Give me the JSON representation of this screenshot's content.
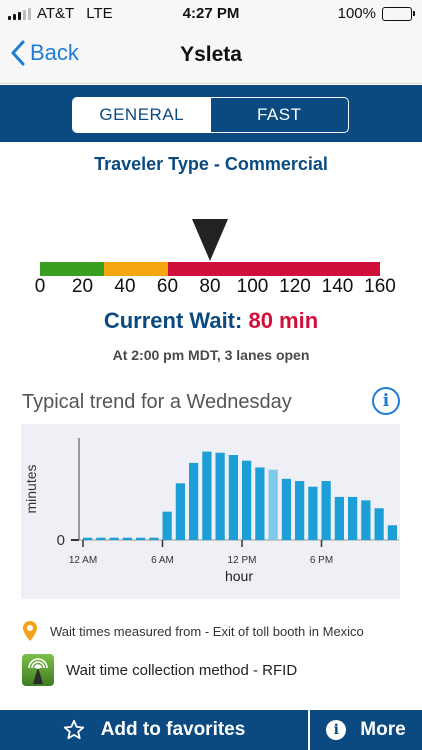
{
  "status_bar": {
    "carrier": "AT&T",
    "network": "LTE",
    "time": "4:27 PM",
    "battery_percent": "100%",
    "battery_level": 1.0,
    "signal_bars": 3,
    "signal_max": 5
  },
  "nav": {
    "back_label": "Back",
    "title": "Ysleta"
  },
  "segment": {
    "options": [
      "GENERAL",
      "FAST"
    ],
    "selected": "GENERAL"
  },
  "traveler_type": "Traveler Type - Commercial",
  "gauge": {
    "ticks": [
      "0",
      "20",
      "40",
      "60",
      "80",
      "100",
      "120",
      "140",
      "160"
    ],
    "min": 0,
    "max": 160,
    "value": 80,
    "segments": [
      {
        "from": 0,
        "to": 30,
        "color": "#3a9e1f"
      },
      {
        "from": 30,
        "to": 60,
        "color": "#f5a712"
      },
      {
        "from": 60,
        "to": 160,
        "color": "#d0103a"
      }
    ]
  },
  "current_wait": {
    "label": "Current Wait:",
    "value": "80 min"
  },
  "wait_detail": "At 2:00 pm MDT, 3 lanes open",
  "trend_title": "Typical trend for a Wednesday",
  "chart_data": {
    "type": "bar",
    "ylabel": "minutes",
    "xlabel": "hour",
    "y_tick_labels": [
      "0"
    ],
    "x_tick_labels": [
      "12 AM",
      "6 AM",
      "12 PM",
      "6 PM"
    ],
    "x_tick_hours": [
      0,
      6,
      12,
      18
    ],
    "hours": [
      0,
      1,
      2,
      3,
      4,
      5,
      6,
      7,
      8,
      9,
      10,
      11,
      12,
      13,
      14,
      15,
      16,
      17,
      18,
      19,
      20,
      21,
      22,
      23
    ],
    "values": [
      2,
      2,
      2,
      2,
      2,
      2,
      25,
      50,
      68,
      78,
      77,
      75,
      70,
      64,
      62,
      54,
      52,
      47,
      52,
      38,
      38,
      35,
      28,
      13
    ],
    "highlight_hour": 14,
    "bar_color": "#1c9fd6",
    "highlight_color": "#7fcaea",
    "ylim": [
      0,
      90
    ]
  },
  "info_rows": {
    "measured_from": "Wait times measured from - Exit of toll booth in Mexico",
    "collection_method": "Wait time collection method - RFID"
  },
  "bottom_bar": {
    "favorites_label": "Add to favorites",
    "more_label": "More"
  },
  "icons": {
    "back": "chevron-left-icon",
    "info": "info-icon",
    "pin": "location-pin-icon",
    "rfid": "rfid-tower-icon",
    "star": "star-outline-icon",
    "more": "info-filled-icon"
  },
  "colors": {
    "brand_blue": "#0b4a80",
    "link_blue": "#1d7dd6",
    "alert_red": "#d0103a",
    "pin_orange": "#f3a21b"
  }
}
